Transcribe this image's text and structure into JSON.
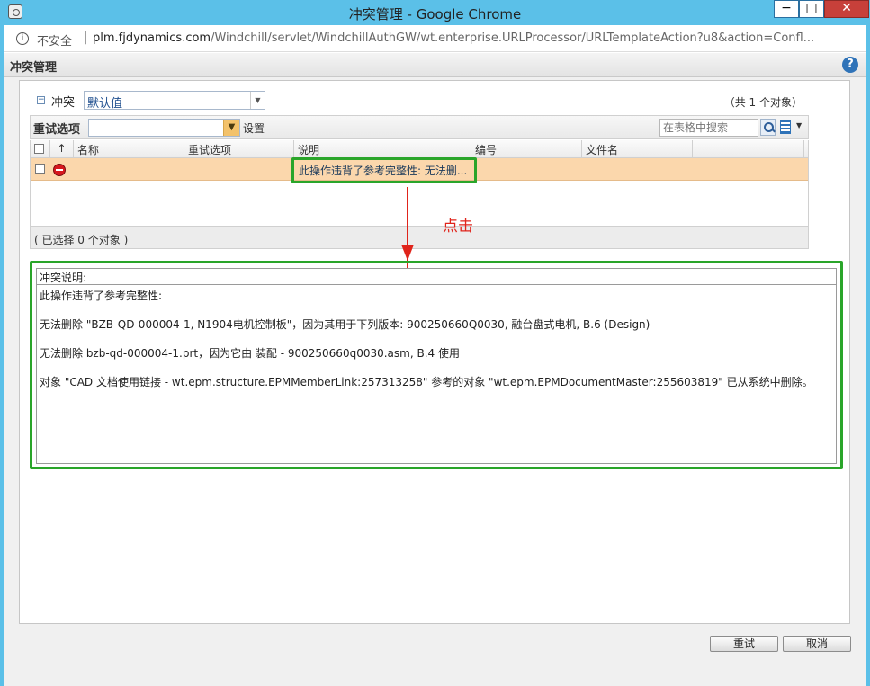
{
  "window": {
    "title": "冲突管理 - Google Chrome",
    "min_glyph": "−",
    "max_glyph": "□",
    "close_glyph": "✕"
  },
  "urlbar": {
    "security_label": "不安全",
    "separator": "|",
    "host": "plm.fjdynamics.com",
    "path": "/Windchill/servlet/WindchillAuthGW/wt.enterprise.URLProcessor/URLTemplateAction?u8&action=Confl..."
  },
  "page": {
    "title": "冲突管理",
    "help_glyph": "?"
  },
  "conflict": {
    "collapse_glyph": "−",
    "label": "冲突",
    "selected_value": "默认值",
    "count_text": "（共 1 个对象）"
  },
  "toolbar": {
    "retry_label": "重试选项",
    "retry_value": "",
    "set_label": "设置",
    "search_placeholder": "在表格中搜索"
  },
  "table": {
    "sort_glyph": "↑",
    "columns": [
      "名称",
      "重试选项",
      "说明",
      "编号",
      "文件名"
    ],
    "rows": [
      {
        "name": "",
        "retry": "",
        "description": "此操作违背了参考完整性: 无法删...",
        "number": "",
        "filename": ""
      }
    ],
    "selected_count": "( 已选择 0 个对象 )"
  },
  "annotation": {
    "click_label": "点击",
    "highlight_color": "#2aa52a",
    "arrow_color": "#e0241b"
  },
  "description": {
    "header": "冲突说明:",
    "lines": [
      "此操作违背了参考完整性:",
      "无法删除 \"BZB-QD-000004-1, N1904电机控制板\"，因为其用于下列版本: 900250660Q0030, 融台盘式电机, B.6 (Design)",
      "无法删除 bzb-qd-000004-1.prt，因为它由 装配 - 900250660q0030.asm, B.4 使用",
      "对象 \"CAD 文档使用链接 - wt.epm.structure.EPMMemberLink:257313258\" 参考的对象 \"wt.epm.EPMDocumentMaster:255603819\" 已从系统中删除。"
    ]
  },
  "buttons": {
    "retry": "重试",
    "cancel": "取消"
  }
}
